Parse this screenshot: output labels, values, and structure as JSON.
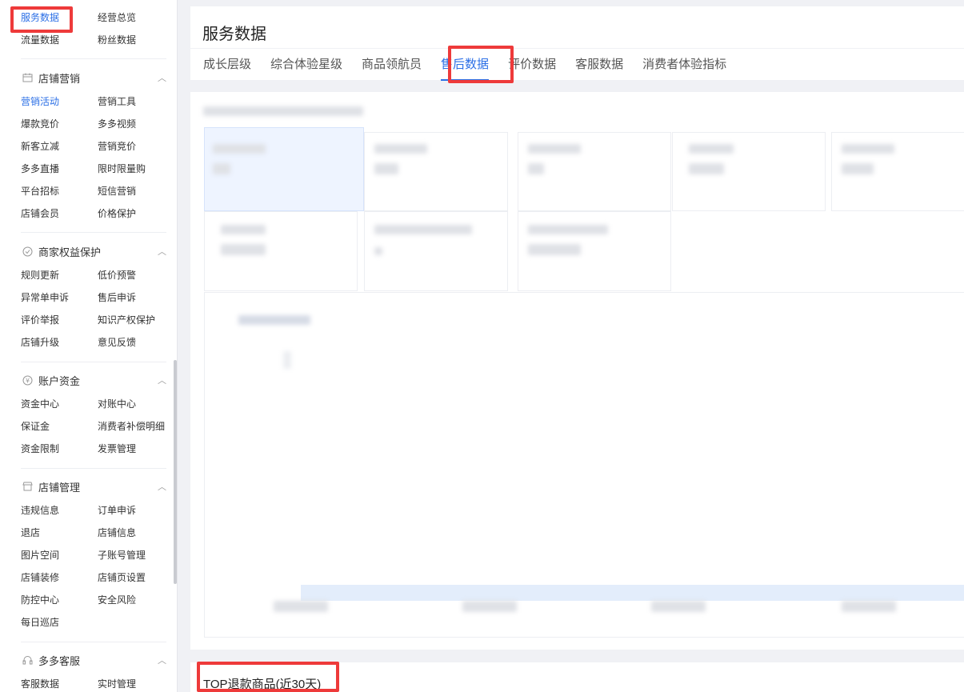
{
  "sidebar": {
    "top_items": [
      "服务数据",
      "经营总览",
      "流量数据",
      "粉丝数据"
    ],
    "sections": [
      {
        "title": "店铺营销",
        "icon": "calendar-icon",
        "items": [
          "营销活动",
          "营销工具",
          "爆款竞价",
          "多多视频",
          "新客立减",
          "营销竞价",
          "多多直播",
          "限时限量购",
          "平台招标",
          "短信营销",
          "店铺会员",
          "价格保护"
        ]
      },
      {
        "title": "商家权益保护",
        "icon": "shield-icon",
        "items": [
          "规则更新",
          "低价预警",
          "异常单申诉",
          "售后申诉",
          "评价举报",
          "知识产权保护",
          "店铺升级",
          "意见反馈"
        ]
      },
      {
        "title": "账户资金",
        "icon": "yen-icon",
        "items": [
          "资金中心",
          "对账中心",
          "保证金",
          "消费者补偿明细",
          "资金限制",
          "发票管理"
        ]
      },
      {
        "title": "店铺管理",
        "icon": "store-icon",
        "items": [
          "违规信息",
          "订单申诉",
          "退店",
          "店铺信息",
          "图片空间",
          "子账号管理",
          "店铺装修",
          "店铺页设置",
          "防控中心",
          "安全风险",
          "每日巡店"
        ]
      },
      {
        "title": "多多客服",
        "icon": "headset-icon",
        "items": [
          "客服数据",
          "实时管理"
        ]
      }
    ],
    "active_item": "服务数据",
    "active_secondary": "营销活动"
  },
  "main": {
    "page_title": "服务数据",
    "tabs": [
      "成长层级",
      "综合体验星级",
      "商品领航员",
      "售后数据",
      "评价数据",
      "客服数据",
      "消费者体验指标"
    ],
    "active_tab": "售后数据",
    "bottom_section_title": "TOP退款商品(近30天)"
  },
  "colors": {
    "accent": "#2b6fe6",
    "highlight_box": "#ee3a3a",
    "background": "#f0f1f5"
  }
}
